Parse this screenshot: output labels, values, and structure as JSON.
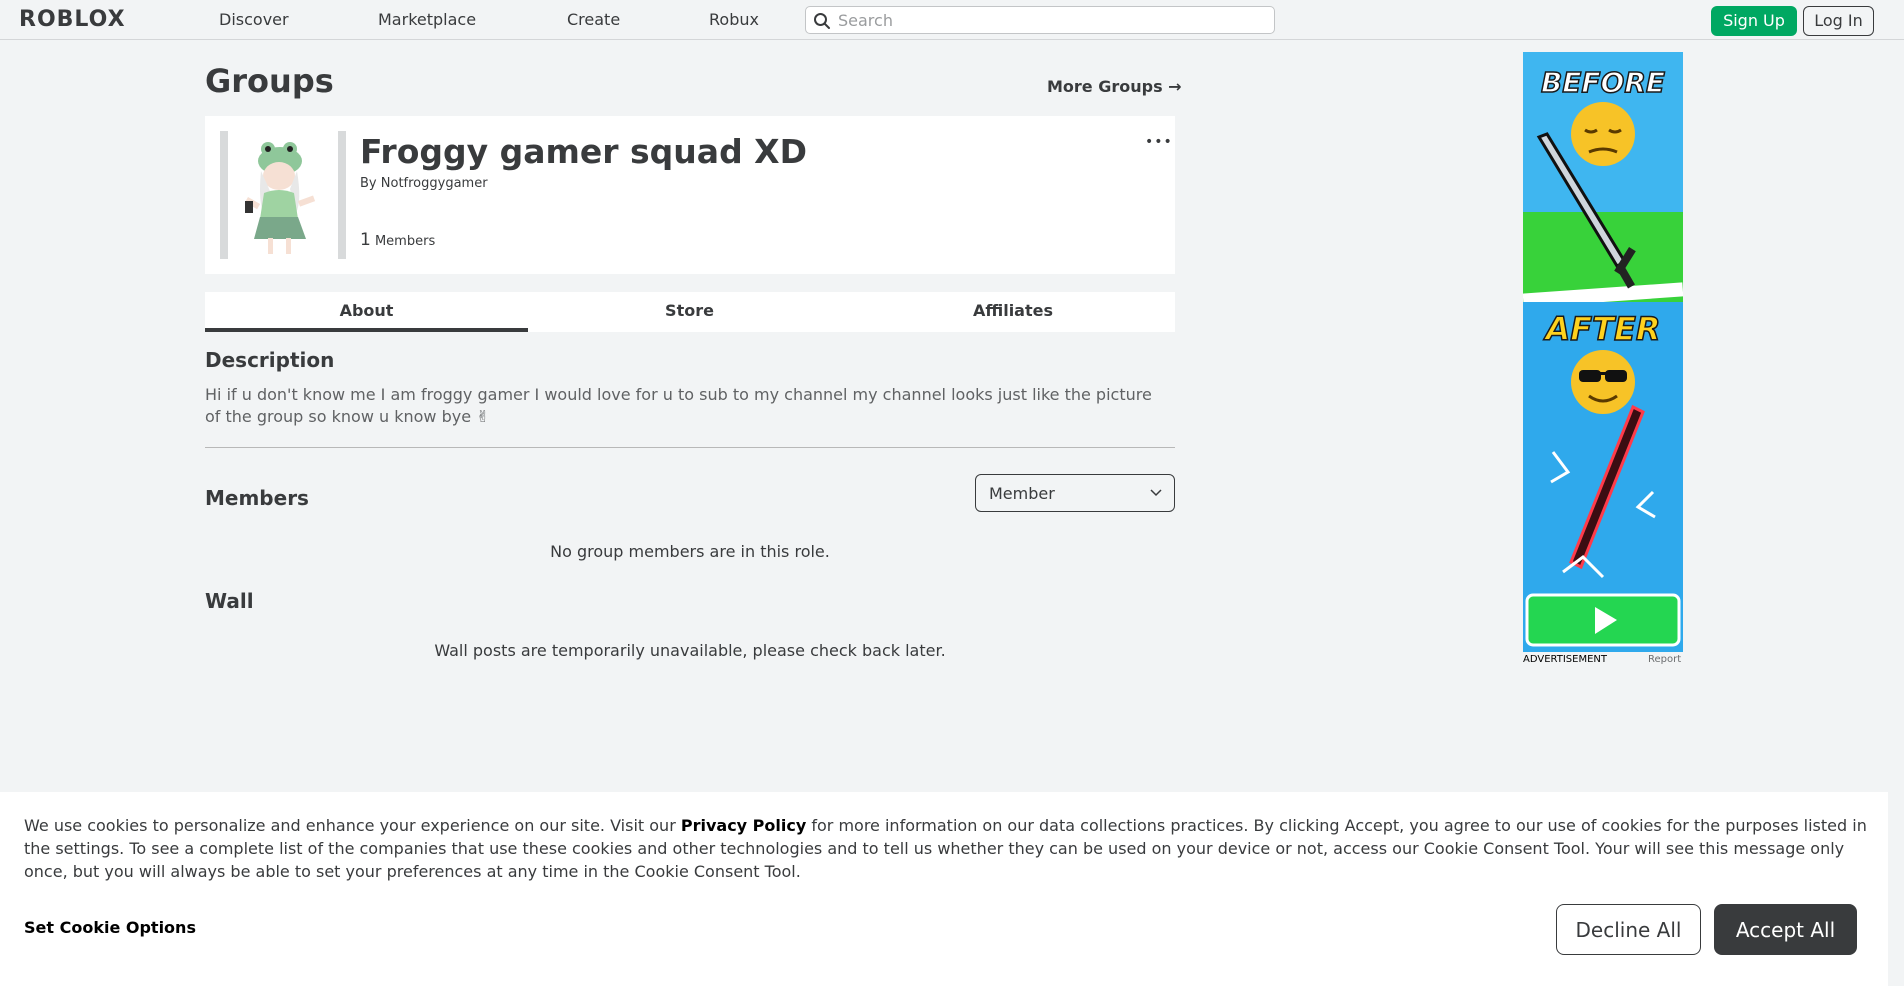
{
  "header": {
    "logo": "ROBLOX",
    "nav": [
      "Discover",
      "Marketplace",
      "Create",
      "Robux"
    ],
    "search_placeholder": "Search",
    "signup_label": "Sign Up",
    "login_label": "Log In"
  },
  "page": {
    "title": "Groups",
    "more_groups": "More Groups →"
  },
  "group": {
    "name": "Froggy gamer squad XD",
    "by_label": "By",
    "owner": "Notfroggygamer",
    "member_count": "1",
    "members_label": "Members",
    "more_icon": "•••"
  },
  "tabs": [
    "About",
    "Store",
    "Affiliates"
  ],
  "about": {
    "description_title": "Description",
    "description": "Hi if u don't know me I am froggy gamer I would love for u to sub to my channel my channel looks just like the picture of the group so know u know bye ✌",
    "members_title": "Members",
    "role_selected": "Member",
    "members_empty": "No group members are in this role.",
    "wall_title": "Wall",
    "wall_empty": "Wall posts are temporarily unavailable, please check back later."
  },
  "ad": {
    "before_text": "BEFORE",
    "after_text": "AFTER",
    "label": "ADVERTISEMENT",
    "report": "Report"
  },
  "cookie": {
    "text_pre": "We use cookies to personalize and enhance your experience on our site. Visit our ",
    "privacy_link": "Privacy Policy",
    "text_post": " for more information on our data collections practices. By clicking Accept, you agree to our use of cookies for the purposes listed in the settings. To see a complete list of the companies that use these cookies and other technologies and to tell us whether they can be used on your device or not, access our Cookie Consent Tool. Your will see this message only once, but you will always be able to set your preferences at any time in the Cookie Consent Tool.",
    "set_options": "Set Cookie Options",
    "decline": "Decline All",
    "accept": "Accept All"
  },
  "colors": {
    "signup_green": "#00a862",
    "text_dark": "#393b3d",
    "background": "#f2f4f5"
  }
}
